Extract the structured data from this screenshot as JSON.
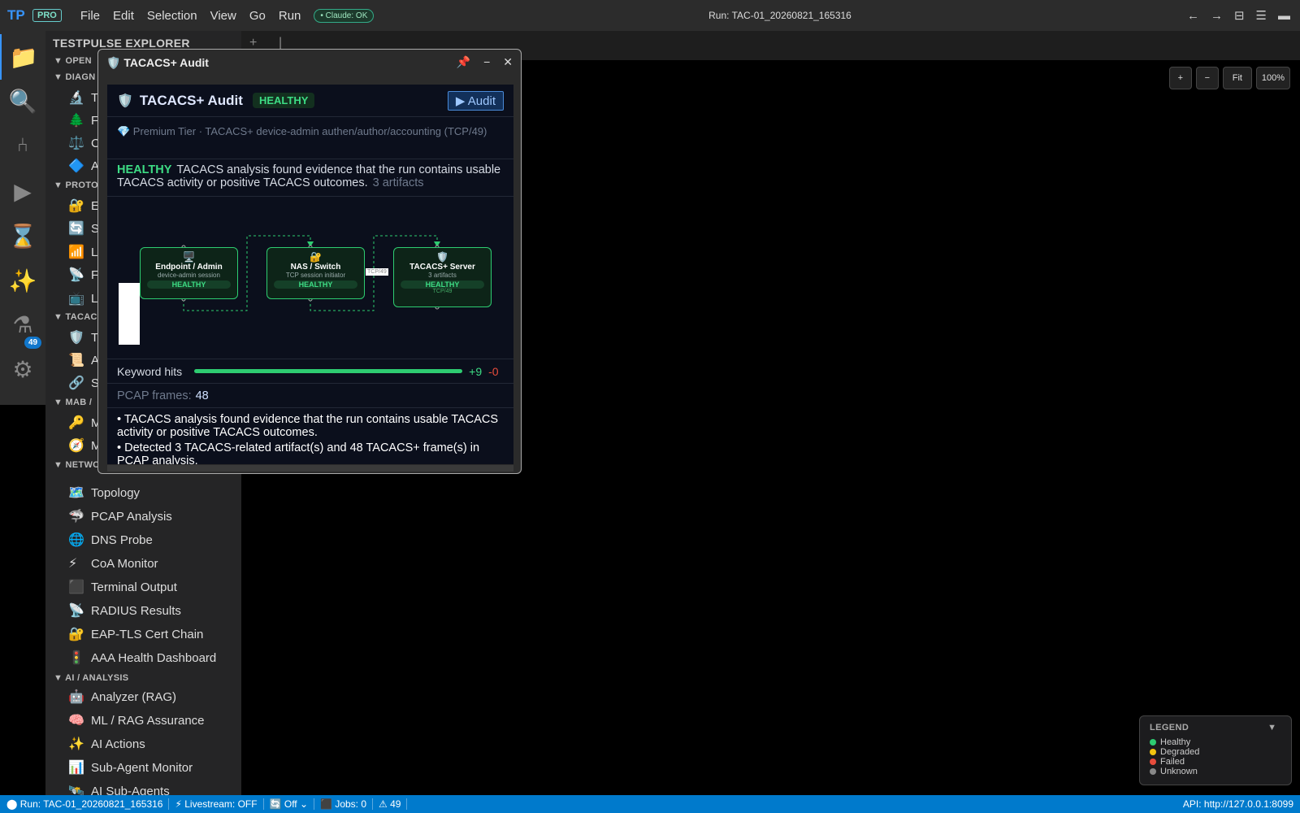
{
  "titlebar": {
    "logo": "TP",
    "pro_badge": "PRO",
    "menus": [
      "File",
      "Edit",
      "Selection",
      "View",
      "Go",
      "Run"
    ],
    "claude_status": "• Claude: OK",
    "run_title": "Run: TAC-01_20260821_165316"
  },
  "activity": {
    "badge": "49"
  },
  "sidebar": {
    "title": "TESTPULSE EXPLORER",
    "sections": {
      "open": "▼ OPEN",
      "diag": "▼ DIAGN",
      "proto": "▼ PROTO",
      "tacacs": "▼ TACAC",
      "mab": "▼ MAB /",
      "network": "▼ NETWORK",
      "ai": "▼ AI / ANALYSIS"
    },
    "partial_items": [
      "T",
      "F",
      "C",
      "A",
      "E",
      "S",
      "L",
      "F",
      "L",
      "T",
      "A",
      "S",
      "M",
      "M"
    ],
    "network_items": [
      "Topology",
      "PCAP Analysis",
      "DNS Probe",
      "CoA Monitor",
      "Terminal Output",
      "RADIUS Results",
      "EAP-TLS Cert Chain",
      "AAA Health Dashboard"
    ],
    "ai_items": [
      "Analyzer (RAG)",
      "ML / RAG Assurance",
      "AI Actions",
      "Sub-Agent Monitor",
      "AI Sub-Agents"
    ]
  },
  "tabs": {
    "add": "+",
    "sep": "|"
  },
  "zoom": {
    "in": "+",
    "out": "−",
    "fit": "Fit",
    "level": "100%"
  },
  "legend": {
    "title": "LEGEND",
    "collapse": "▼",
    "items": [
      {
        "label": "Healthy",
        "color": "#2ecc71"
      },
      {
        "label": "Degraded",
        "color": "#f1c40f"
      },
      {
        "label": "Failed",
        "color": "#e74c3c"
      },
      {
        "label": "Unknown",
        "color": "#888888"
      }
    ]
  },
  "status": {
    "run": "⬤ Run: TAC-01_20260821_165316",
    "livestream": "⚡ Livestream: OFF",
    "refresh_value": "Off",
    "jobs": "⬛ Jobs: 0",
    "warnings": "⚠ 49",
    "api": "API: http://127.0.0.1:8099"
  },
  "dialog": {
    "title": "TACACS+ Audit",
    "header_title": "TACACS+ Audit",
    "status_badge": "HEALTHY",
    "audit_button": "▶ Audit",
    "tier_text": "💎 Premium Tier · TACACS+ device-admin authen/author/accounting (TCP/49)",
    "summary_status": "HEALTHY",
    "summary_text": "TACACS analysis found evidence that the run contains usable TACACS activity or positive TACACS outcomes.",
    "summary_artifacts": "3 artifacts",
    "nodes": [
      {
        "icon": "🖥️",
        "title": "Endpoint / Admin",
        "sub": "device-admin session",
        "status": "HEALTHY"
      },
      {
        "icon": "🔐",
        "title": "NAS / Switch",
        "sub": "TCP session initiator",
        "status": "HEALTHY"
      },
      {
        "icon": "🛡️",
        "title": "TACACS+ Server",
        "sub": "3 artifacts",
        "status": "HEALTHY",
        "port": "TCP/49"
      }
    ],
    "edge_label": "TCP/49",
    "keyword_label": "Keyword hits",
    "keyword_pos": "+9",
    "keyword_neg": "-0",
    "keyword_fraction": 1.0,
    "pcap_label": "PCAP frames:",
    "pcap_value": "48",
    "findings": [
      "• TACACS analysis found evidence that the run contains usable TACACS activity or positive TACACS outcomes.",
      "• Detected 3 TACACS-related artifact(s) and 48 TACACS+ frame(s) in PCAP analysis."
    ]
  }
}
